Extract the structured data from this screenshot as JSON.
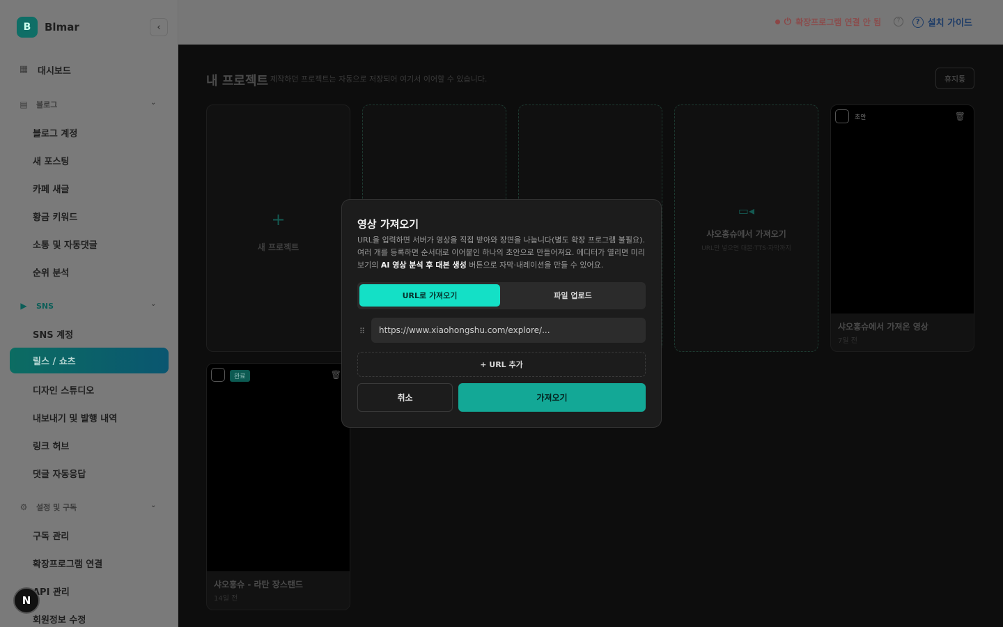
{
  "brand": {
    "logo_letter": "B",
    "name": "Blmar"
  },
  "sidebar": {
    "collapse_icon": "chevron-left-icon",
    "dashboard": {
      "label": "대시보드",
      "icon": "grid-icon"
    },
    "blog_group": {
      "label": "블로그",
      "icon": "document-icon"
    },
    "blog_items": [
      "블로그 계정",
      "새 포스팅",
      "카페 새글",
      "황금 키워드",
      "소통 및 자동댓글",
      "순위 분석"
    ],
    "sns_group": {
      "label": "SNS",
      "icon": "play-icon"
    },
    "sns_items": [
      "SNS 계정",
      "릴스 / 쇼츠",
      "디자인 스튜디오",
      "내보내기 및 발행 내역",
      "링크 허브",
      "댓글 자동응답"
    ],
    "active_item": "릴스 / 쇼츠",
    "settings_group": {
      "label": "설정 및 구독",
      "icon": "gear-icon"
    },
    "settings_items": [
      "구독 관리",
      "확장프로그램 연결",
      "API 관리",
      "회원정보 수정"
    ],
    "n_badge": "N"
  },
  "topbar": {
    "extension_status": "확장프로그램 연결 안 됨",
    "status_color": "#8c4646",
    "help_icon": "clock-icon",
    "guide_label": "설치 가이드",
    "guide_color": "#1c3b67"
  },
  "main": {
    "title": "내 프로젝트",
    "subtitle": "제작하던 프로젝트는 자동으로 저장되어 여기서 이어할 수 있습니다.",
    "trash_label": "휴지통",
    "new_project_label": "새 프로젝트",
    "xhs_card": {
      "label": "샤오홍슈에서 가져오기",
      "sub": "URL만 넣으면 대본·TTS·자막까지"
    },
    "draft_card": {
      "tag": "초안",
      "title": "샤오홍슈에서 가져온 영상",
      "time": "7일 전"
    },
    "done_card": {
      "tag": "완료",
      "title": "샤오홍슈 - 라탄 장스탠드",
      "time": "14일 전"
    }
  },
  "modal": {
    "title": "영상 가져오기",
    "desc_part1": "URL을 입력하면 서버가 영상을 직접 받아와 장면을 나눕니다(별도 확장 프로그램 불필요). 여러 개를 등록하면 순서대로 이어붙인 하나의 초안으로 만들어져요. 에디터가 열리면 미리보기의 ",
    "desc_bold": "AI 영상 분석 후 대본 생성",
    "desc_part2": " 버튼으로 자막·내레이션을 만들 수 있어요.",
    "tab_url": "URL로 가져오기",
    "tab_file": "파일 업로드",
    "url_value": "https://www.xiaohongshu.com/explore/...",
    "add_url_label": "+ URL 추가",
    "cancel_label": "취소",
    "import_label": "가져오기",
    "accent_color": "#14e0c6"
  }
}
